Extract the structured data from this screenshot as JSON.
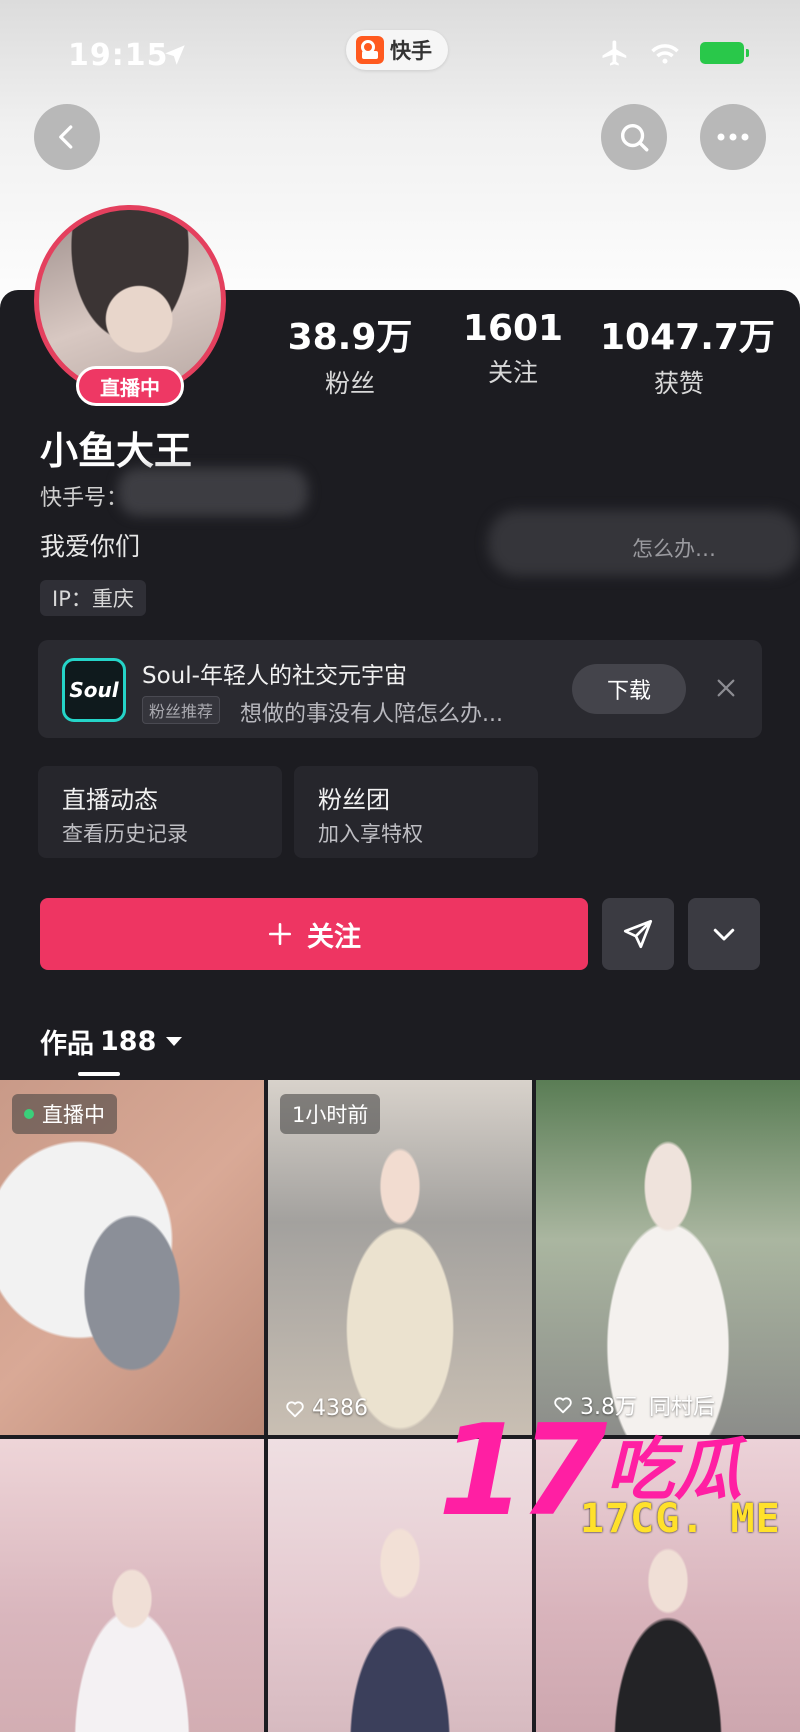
{
  "status_bar": {
    "time": "19:15",
    "app_name": "快手"
  },
  "profile": {
    "live_badge": "直播中",
    "username": "小鱼大王",
    "kuaishou_id_label": "快手号：",
    "bio": "我爱你们",
    "bio_ghost_text": "怎么办…",
    "ip": "IP：重庆",
    "stats": [
      {
        "value": "38.9万",
        "label": "粉丝"
      },
      {
        "value": "1601",
        "label": "关注"
      },
      {
        "value": "1047.7万",
        "label": "获赞"
      }
    ]
  },
  "ad": {
    "logo_text": "Soul",
    "title": "Soul-年轻人的社交元宇宙",
    "tag": "粉丝推荐",
    "description": "想做的事没有人陪怎么办...",
    "download_label": "下载"
  },
  "features": [
    {
      "title": "直播动态",
      "subtitle": "查看历史记录"
    },
    {
      "title": "粉丝团",
      "subtitle": "加入享特权"
    }
  ],
  "actions": {
    "follow_label": "关注"
  },
  "works": {
    "label": "作品",
    "count": "188"
  },
  "tiles": [
    {
      "badge": "直播中",
      "likes": ""
    },
    {
      "badge": "1小时前",
      "likes": "4386"
    },
    {
      "badge": "",
      "likes": "3.8万"
    },
    {
      "badge": "",
      "likes": ""
    },
    {
      "badge": "",
      "likes": ""
    },
    {
      "badge": "",
      "likes": ""
    }
  ],
  "tile3_overlay": "同村后",
  "watermark": {
    "number": "17",
    "chinese": "吃瓜",
    "url": "17CG. ME"
  },
  "colors": {
    "accent": "#ee3562",
    "background": "#1c1c21",
    "live_green": "#3ad07a",
    "watermark_pink": "#ff1fa3",
    "watermark_yellow": "#ffe12b"
  }
}
